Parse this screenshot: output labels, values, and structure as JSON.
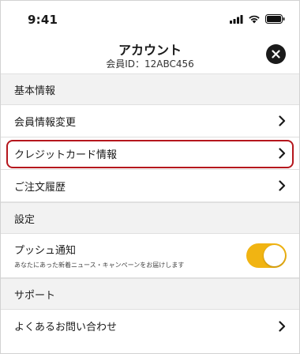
{
  "status_bar": {
    "time": "9:41",
    "icons": [
      "signal-icon",
      "wifi-icon",
      "battery-icon"
    ]
  },
  "header": {
    "title": "アカウント",
    "member_id": "会員ID：12ABC456",
    "close_icon": "close-icon"
  },
  "sections": {
    "basic": {
      "label": "基本情報",
      "items": [
        {
          "label": "会員情報変更"
        },
        {
          "label": "クレジットカード情報",
          "highlighted": true
        },
        {
          "label": "ご注文履歴"
        }
      ]
    },
    "settings": {
      "label": "設定",
      "push": {
        "title": "プッシュ通知",
        "description": "あなたにあった新着ニュース・キャンペーンをお届けします",
        "enabled": true
      }
    },
    "support": {
      "label": "サポート",
      "items": [
        {
          "label": "よくあるお問い合わせ"
        }
      ]
    }
  },
  "colors": {
    "accent_toggle": "#f1b412",
    "highlight_border": "#b5171d",
    "section_bg": "#f2f2f2"
  }
}
